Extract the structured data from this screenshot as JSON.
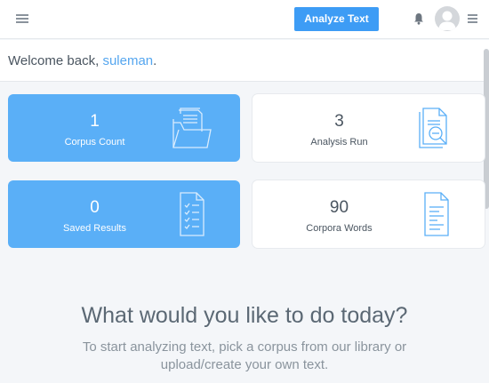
{
  "header": {
    "analyze_button": "Analyze Text",
    "left_menu_icon": "hamburger-icon",
    "right_menu_icon": "hamburger-icon",
    "notification_icon": "bell-icon",
    "avatar_icon": "user-avatar-icon"
  },
  "welcome": {
    "prefix": "Welcome back, ",
    "username": "suleman",
    "suffix": "."
  },
  "stats": [
    {
      "value": "1",
      "label": "Corpus Count",
      "icon": "folder-documents-icon"
    },
    {
      "value": "3",
      "label": "Analysis Run",
      "icon": "document-search-icon"
    },
    {
      "value": "0",
      "label": "Saved Results",
      "icon": "checklist-icon"
    },
    {
      "value": "90",
      "label": "Corpora Words",
      "icon": "text-document-icon"
    }
  ],
  "prompt": {
    "title": "What would you like to do today?",
    "subtitle": "To start analyzing text, pick a corpus from our library or upload/create your own text."
  },
  "colors": {
    "accent": "#3d9cf5",
    "card_blue": "#5aaff7",
    "username": "#55a6ef"
  }
}
